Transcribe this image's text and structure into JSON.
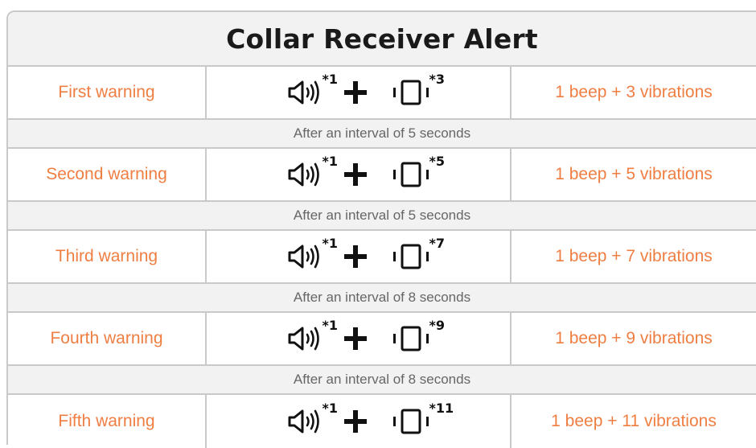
{
  "title": "Collar Receiver Alert",
  "rows": [
    {
      "warning": "First warning",
      "beep_count": "*1",
      "vibe_count": "*3",
      "result": "1 beep + 3 vibrations"
    },
    {
      "warning": "Second warning",
      "beep_count": "*1",
      "vibe_count": "*5",
      "result": "1 beep + 5 vibrations"
    },
    {
      "warning": "Third warning",
      "beep_count": "*1",
      "vibe_count": "*7",
      "result": "1 beep + 7 vibrations"
    },
    {
      "warning": "Fourth warning",
      "beep_count": "*1",
      "vibe_count": "*9",
      "result": "1 beep + 9 vibrations"
    },
    {
      "warning": "Fifth warning",
      "beep_count": "*1",
      "vibe_count": "*11",
      "result": "1 beep + 11 vibrations"
    }
  ],
  "intervals": [
    "After an interval of 5 seconds",
    "After an interval of 5 seconds",
    "After an interval of 8 seconds",
    "After an interval of 8 seconds"
  ],
  "icons": {
    "beep": "speaker-icon",
    "add": "plus-icon",
    "vibrate": "vibration-icon"
  },
  "colors": {
    "accent": "#ef7e43",
    "header_bg": "#f2f2f2",
    "border": "#c9c9c9",
    "interval_text": "#666666"
  }
}
